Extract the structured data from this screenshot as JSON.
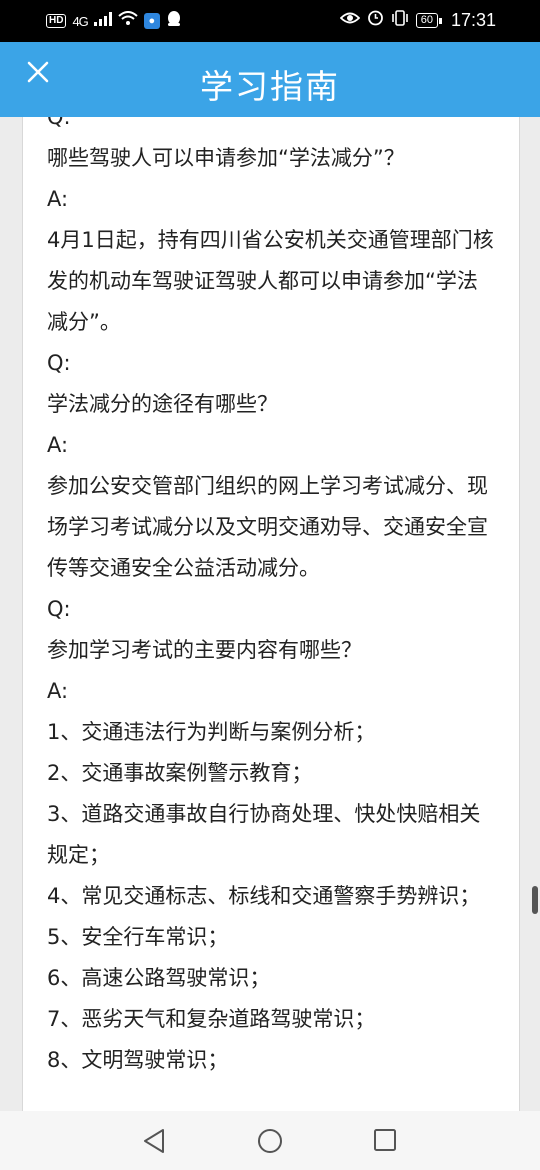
{
  "status_bar": {
    "hd": "HD",
    "network": "4G",
    "battery": "60",
    "time": "17:31"
  },
  "header": {
    "title": "学习指南"
  },
  "content": {
    "lines": [
      "Q:",
      "哪些驾驶人可以申请参加“学法减分”？",
      "A:",
      "4月1日起，持有四川省公安机关交通管理部门核发的机动车驾驶证驾驶人都可以申请参加“学法减分”。",
      "Q:",
      "学法减分的途径有哪些？",
      "A:",
      "参加公安交管部门组织的网上学习考试减分、现场学习考试减分以及文明交通劝导、交通安全宣传等交通安全公益活动减分。",
      "Q:",
      "参加学习考试的主要内容有哪些？",
      "A:",
      "1、交通违法行为判断与案例分析；",
      "2、交通事故案例警示教育；",
      "3、道路交通事故自行协商处理、快处快赔相关规定；",
      "4、常见交通标志、标线和交通警察手势辨识；",
      "5、安全行车常识；",
      "6、高速公路驾驶常识；",
      "7、恶劣天气和复杂道路驾驶常识；",
      "8、文明驾驶常识；"
    ]
  },
  "icons": {
    "close": "close-icon",
    "back": "back-triangle-icon",
    "home": "home-circle-icon",
    "recents": "recents-square-icon"
  },
  "colors": {
    "header_bg": "#3ba4e7",
    "text": "#222222"
  }
}
